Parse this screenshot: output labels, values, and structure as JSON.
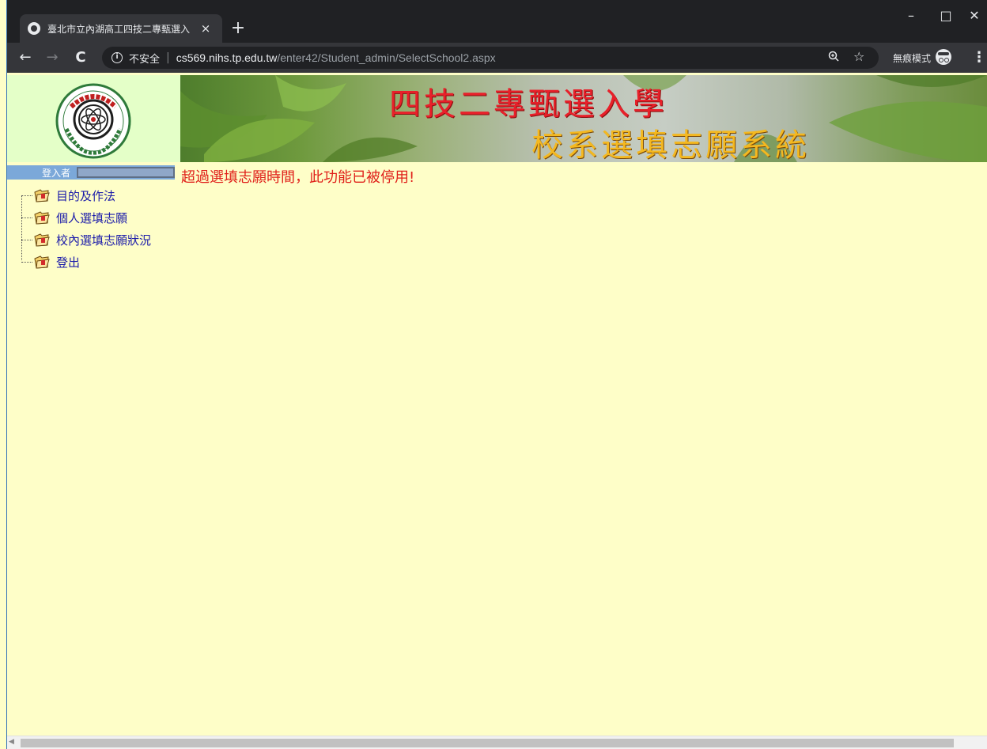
{
  "browser": {
    "tab_title": "臺北市立內湖高工四技二專甄選入",
    "tab_close": "×",
    "new_tab": "+",
    "window_controls": {
      "minimize": "–",
      "maximize": "□",
      "close": "✕"
    },
    "nav": {
      "back": "←",
      "forward": "→",
      "reload": "C"
    },
    "address": {
      "security_label": "不安全",
      "host": "cs569.nihs.tp.edu.tw",
      "path": "/enter42/Student_admin/SelectSchool2.aspx"
    },
    "incognito_label": "無痕模式",
    "icons": [
      "globe-icon",
      "info-icon",
      "zoom-icon",
      "star-icon",
      "incognito-icon",
      "menu-icon"
    ]
  },
  "header": {
    "banner_line1": "四技二專甄選入學",
    "banner_line2": "校系選填志願系統"
  },
  "sidebar": {
    "login_label": "登入者",
    "login_value": "",
    "items": [
      {
        "label": "目的及作法"
      },
      {
        "label": "個人選填志願"
      },
      {
        "label": "校內選填志願狀況"
      },
      {
        "label": "登出"
      }
    ]
  },
  "main": {
    "notice": "超過選填志願時間，此功能已被停用!"
  },
  "colors": {
    "page_background": "#fefec8",
    "notice_text": "#e0201a",
    "link_text": "#1c1caa",
    "banner_title_red": "#e8202a",
    "banner_title_orange": "#f4b820",
    "login_bar": "#7ba8d9"
  }
}
